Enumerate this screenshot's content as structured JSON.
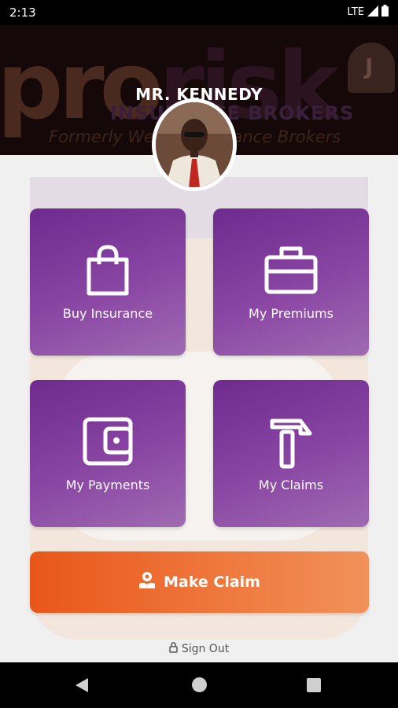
{
  "status_bar": {
    "time": "2:13",
    "network": "LTE"
  },
  "header": {
    "watermark_brand_part1": "pro",
    "watermark_brand_part2": "risk",
    "watermark_subtitle": "INSURANCE BROKERS",
    "watermark_tagline": "Formerly Wealth Insurance Brokers",
    "user_name": "MR. KENNEDY"
  },
  "tiles": [
    {
      "label": "Buy Insurance",
      "icon": "shopping-bag-icon"
    },
    {
      "label": "My Premiums",
      "icon": "briefcase-icon"
    },
    {
      "label": "My Payments",
      "icon": "wallet-icon"
    },
    {
      "label": "My Claims",
      "icon": "hammer-icon"
    }
  ],
  "make_claim": {
    "label": "Make Claim",
    "icon": "claim-hand-icon"
  },
  "sign_out": {
    "label": "Sign Out",
    "icon": "lock-icon"
  },
  "colors": {
    "tile_purple": "#7b3a98",
    "claim_orange": "#e9561a",
    "header_dark": "#140808"
  }
}
